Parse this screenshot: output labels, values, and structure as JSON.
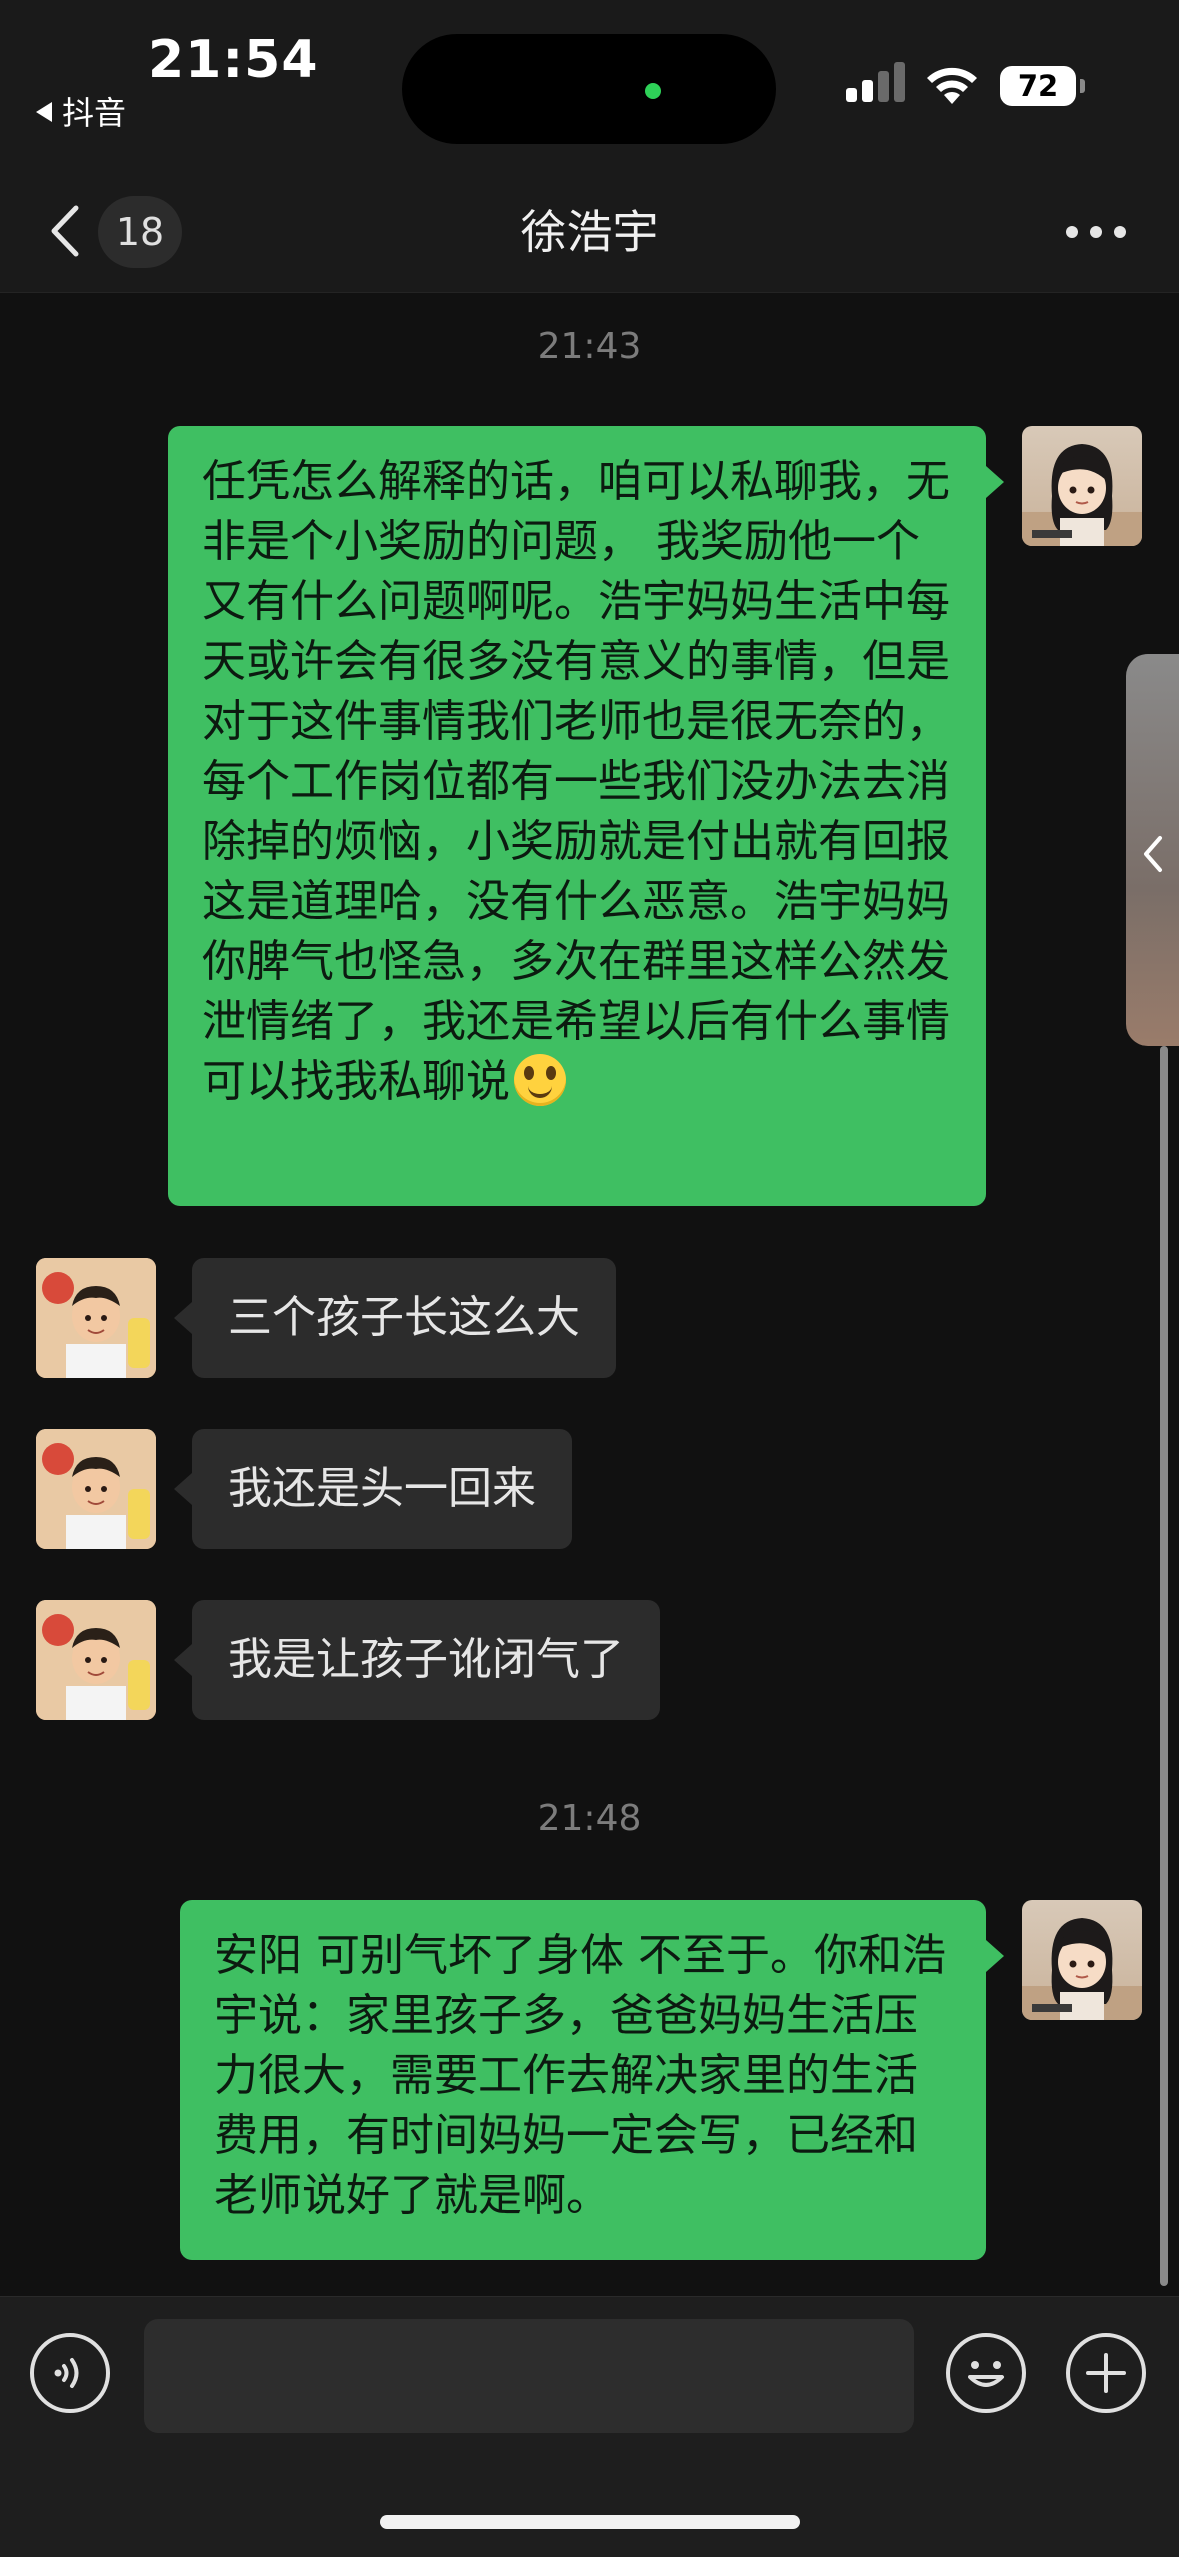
{
  "status_bar": {
    "time": "21:54",
    "back_app": "抖音",
    "battery": "72"
  },
  "nav": {
    "unread_count": "18",
    "title": "徐浩宇"
  },
  "messages": [
    {
      "type": "timestamp",
      "text": "21:43"
    },
    {
      "type": "sent",
      "text": "任凭怎么解释的话，咱可以私聊我，无非是个小奖励的问题， 我奖励他一个又有什么问题啊呢。浩宇妈妈生活中每天或许会有很多没有意义的事情，但是对于这件事情我们老师也是很无奈的，每个工作岗位都有一些我们没办法去消除掉的烦恼，小奖励就是付出就有回报这是道理哈，没有什么恶意。浩宇妈妈你脾气也怪急，多次在群里这样公然发泄情绪了，我还是希望以后有什么事情可以找我私聊说",
      "emoji": "smiling-face-emoji"
    },
    {
      "type": "received",
      "text": "三个孩子长这么大"
    },
    {
      "type": "received",
      "text": "我还是头一回来"
    },
    {
      "type": "received",
      "text": "我是让孩子讹闭气了"
    },
    {
      "type": "timestamp",
      "text": "21:48"
    },
    {
      "type": "sent",
      "text": "安阳 可别气坏了身体 不至于。你和浩宇说：家里孩子多，爸爸妈妈生活压力很大，需要工作去解决家里的生活费用，有时间妈妈一定会写，已经和老师说好了就是啊。"
    }
  ],
  "icons": {
    "back": "chevron-left-icon",
    "more": "more-dots-icon",
    "side": "chevron-left-icon",
    "voice": "voice-icon",
    "emoji": "emoji-icon",
    "plus": "plus-icon"
  },
  "colors": {
    "sent_bubble": "#3fbf62",
    "received_bubble": "#2c2c2c",
    "background": "#111111"
  }
}
